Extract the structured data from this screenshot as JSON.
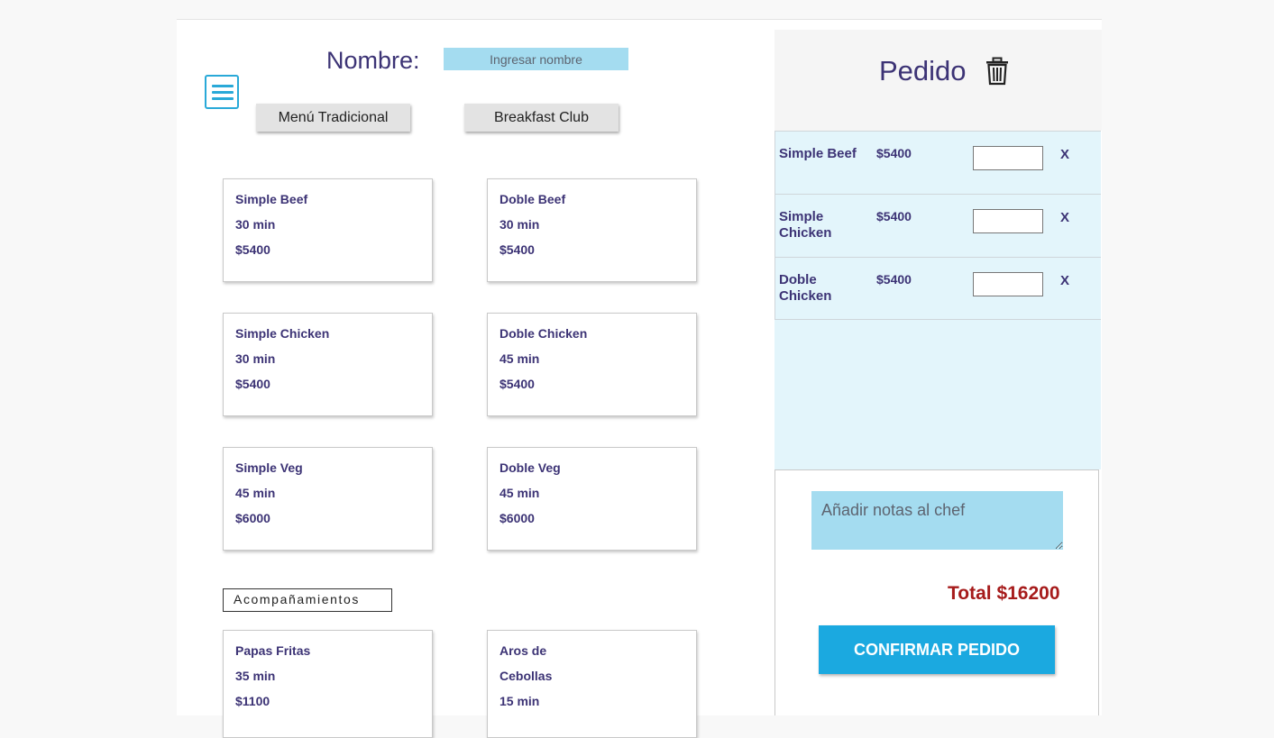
{
  "header": {
    "name_label": "Nombre:",
    "name_placeholder": "Ingresar nombre",
    "menu_buttons": [
      "Menú Tradicional",
      "Breakfast Club"
    ]
  },
  "menu": {
    "items": [
      {
        "name": "Simple Beef",
        "time": "30 min",
        "price": "$5400"
      },
      {
        "name": "Doble Beef",
        "time": "30 min",
        "price": "$5400"
      },
      {
        "name": "Simple Chicken",
        "time": "30 min",
        "price": "$5400"
      },
      {
        "name": "Doble Chicken",
        "time": "45 min",
        "price": "$5400"
      },
      {
        "name": "Simple Veg",
        "time": "45 min",
        "price": "$6000"
      },
      {
        "name": "Doble Veg",
        "time": "45 min",
        "price": "$6000"
      }
    ],
    "sides_label": "Acompañamientos",
    "sides": [
      {
        "name": "Papas Fritas",
        "time": "35 min",
        "price": "$1100"
      },
      {
        "name_line1": "Aros de",
        "name_line2": "Cebollas",
        "time": "15 min"
      }
    ]
  },
  "order": {
    "title": "Pedido",
    "items": [
      {
        "name": "Simple Beef",
        "price": "$5400",
        "remove": "X"
      },
      {
        "name": "Simple Chicken",
        "price": "$5400",
        "remove": "X"
      },
      {
        "name": "Doble Chicken",
        "price": "$5400",
        "remove": "X"
      }
    ],
    "notes_placeholder": "Añadir notas al chef",
    "total": "Total $16200",
    "confirm_label": "CONFIRMAR PEDIDO"
  },
  "colors": {
    "primary_text": "#3c3375",
    "accent_blue": "#1ba9e0",
    "input_blue": "#a4dcf0",
    "total_red": "#a61b1b"
  },
  "icons": [
    "menu-icon",
    "trash-icon"
  ]
}
